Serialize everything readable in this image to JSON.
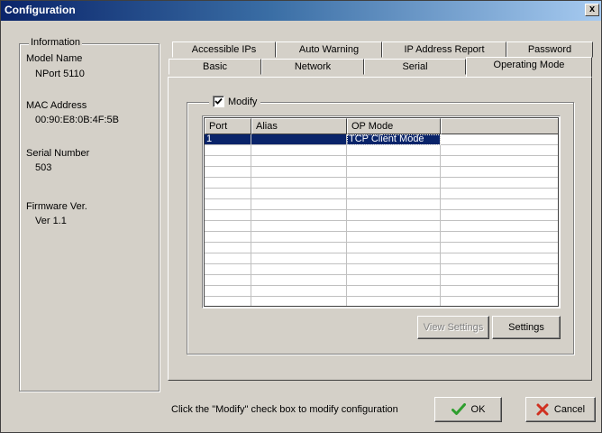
{
  "window": {
    "title": "Configuration",
    "close_label": "x"
  },
  "information": {
    "legend": "Information",
    "model_name_label": "Model Name",
    "model_name_value": "NPort 5110",
    "mac_label": "MAC Address",
    "mac_value": "00:90:E8:0B:4F:5B",
    "serial_label": "Serial Number",
    "serial_value": "503",
    "firmware_label": "Firmware Ver.",
    "firmware_value": "Ver 1.1"
  },
  "tabs": {
    "back": [
      "Accessible IPs",
      "Auto Warning",
      "IP Address Report",
      "Password"
    ],
    "front": [
      "Basic",
      "Network",
      "Serial",
      "Operating Mode"
    ],
    "active": "Operating Mode"
  },
  "modify": {
    "label": "Modify",
    "checked": true
  },
  "grid": {
    "columns": [
      "Port",
      "Alias",
      "OP Mode",
      ""
    ],
    "rows": [
      {
        "port": "1",
        "alias": "",
        "op_mode": "TCP Client Mode",
        "selected": true
      }
    ],
    "empty_rows": 15
  },
  "buttons": {
    "view_settings": "View Settings",
    "settings": "Settings",
    "ok": "OK",
    "cancel": "Cancel"
  },
  "status": {
    "hint": "Click the \"Modify\" check box to modify configuration"
  },
  "colors": {
    "selection": "#0a246a",
    "face": "#d4d0c8",
    "ok_check": "#2e9e2e",
    "cancel_x": "#d03020"
  }
}
